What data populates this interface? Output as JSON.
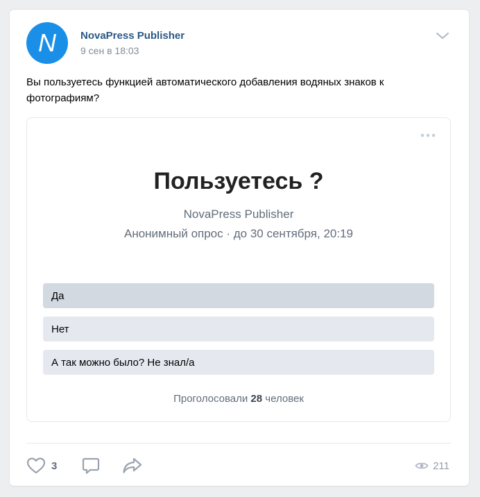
{
  "post": {
    "author": "NovaPress Publisher",
    "avatar_letter": "N",
    "date": "9 сен в 18:03",
    "text": "Вы пользуетесь функцией автоматического добавления водяных знаков к фотографиям?",
    "icons": {
      "menu": "chevron-down-icon",
      "more": "more-horizontal-icon"
    }
  },
  "poll": {
    "title": "Пользуетесь ?",
    "owner": "NovaPress Publisher",
    "meta": "Анонимный опрос · до 30 сентября, 20:19",
    "options": [
      {
        "label": "Да"
      },
      {
        "label": "Нет"
      },
      {
        "label": "А так можно было? Не знал/а"
      }
    ],
    "votes_prefix": "Проголосовали",
    "votes_count": "28",
    "votes_suffix": "человек"
  },
  "actions": {
    "likes": "3",
    "views": "211",
    "icons": {
      "like": "heart-icon",
      "comment": "comment-icon",
      "share": "share-icon",
      "views": "eye-icon"
    }
  },
  "colors": {
    "link": "#2a5885",
    "avatar": "#1a8fe8",
    "option_bg": "#e5e9ef",
    "option_hover_bg": "#d3d9e0",
    "muted": "#818c99"
  }
}
